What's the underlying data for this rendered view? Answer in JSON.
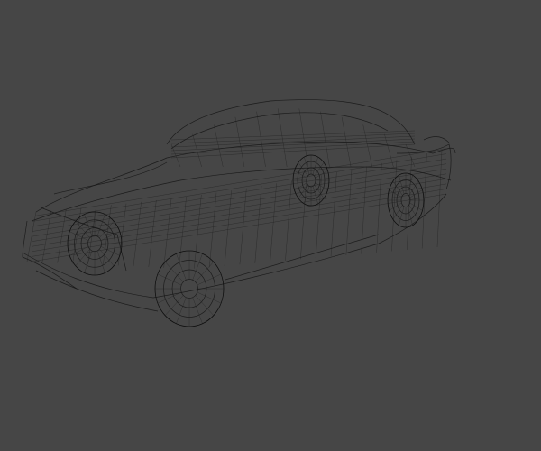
{
  "viewport": {
    "background_color": "#464646",
    "wire_color": "#151515",
    "subject": "car-wireframe"
  }
}
